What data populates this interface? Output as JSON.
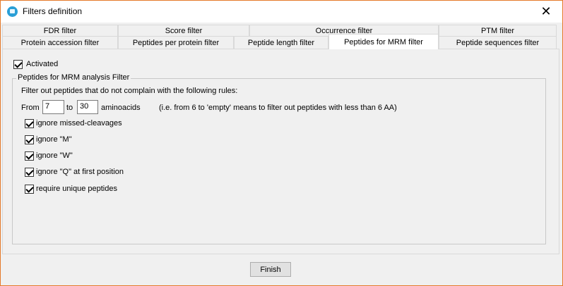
{
  "window": {
    "title": "Filters definition",
    "close_glyph": "✕"
  },
  "tabs": {
    "row1": [
      {
        "label": "FDR filter"
      },
      {
        "label": "Score filter"
      },
      {
        "label": "Occurrence filter"
      },
      {
        "label": "PTM filter"
      }
    ],
    "row2": [
      {
        "label": "Protein accession filter"
      },
      {
        "label": "Peptides per protein filter"
      },
      {
        "label": "Peptide length filter"
      },
      {
        "label": "Peptides for MRM filter"
      },
      {
        "label": "Peptide sequences filter"
      }
    ],
    "selected": "Peptides for MRM filter"
  },
  "panel": {
    "activated": {
      "label": "Activated",
      "checked": true
    },
    "group": {
      "title": "Peptides for MRM analysis Filter",
      "description": "Filter out peptides that do not complain with the following rules:",
      "from_label": "From",
      "from_value": "7",
      "to_label": "to",
      "to_value": "30",
      "unit_label": "aminoacids",
      "hint": "(i.e. from 6 to 'empty' means to filter out peptides with less than 6 AA)",
      "options": [
        {
          "label": "ignore missed-cleavages",
          "checked": true
        },
        {
          "label": "ignore \"M\"",
          "checked": true
        },
        {
          "label": "ignore \"W\"",
          "checked": true
        },
        {
          "label": "ignore \"Q\" at first position",
          "checked": true
        },
        {
          "label": "require unique peptides",
          "checked": true
        }
      ]
    }
  },
  "footer": {
    "finish_label": "Finish"
  },
  "colors": {
    "window_border": "#e57a2a",
    "app_icon": "#2a9fd6",
    "background": "#f0f0f0"
  }
}
